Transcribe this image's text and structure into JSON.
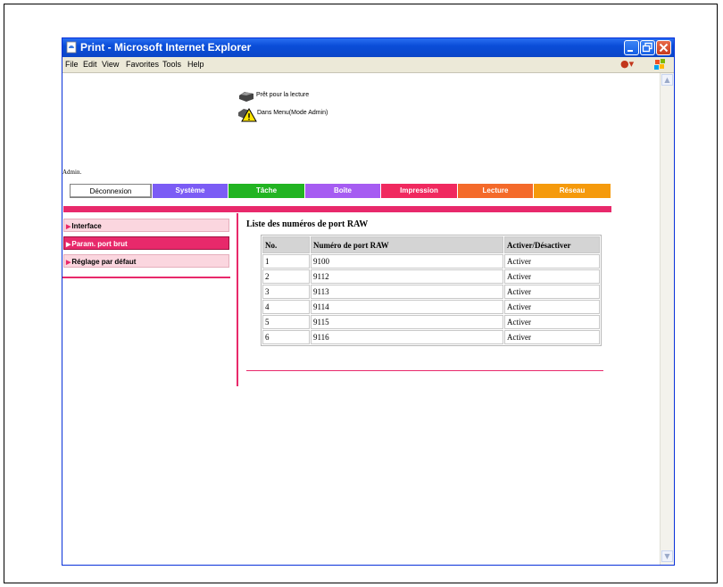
{
  "window": {
    "title": "Print - Microsoft Internet Explorer"
  },
  "menu": {
    "items": [
      "File",
      "Edit",
      "View",
      "Favorites",
      "Tools",
      "Help"
    ]
  },
  "status": {
    "ready": "Prêt pour la lecture",
    "mode": "Dans Menu(Mode Admin)"
  },
  "admin_label": "Admin.",
  "nav": {
    "logout": "Déconnexion",
    "tabs": [
      {
        "label": "Système",
        "color": "#7b5cf5"
      },
      {
        "label": "Tâche",
        "color": "#22b422"
      },
      {
        "label": "Boîte",
        "color": "#a65cf2"
      },
      {
        "label": "Impression",
        "color": "#f0295f"
      },
      {
        "label": "Lecture",
        "color": "#f46a2a"
      },
      {
        "label": "Réseau",
        "color": "#f59a0c"
      }
    ]
  },
  "sidebar": {
    "items": [
      {
        "label": "Interface",
        "active": false
      },
      {
        "label": "Param. port brut",
        "active": true
      },
      {
        "label": "Réglage par défaut",
        "active": false
      }
    ]
  },
  "main": {
    "title": "Liste des numéros de port RAW",
    "table": {
      "headers": [
        "No.",
        "Numéro de port RAW",
        "Activer/Désactiver"
      ],
      "rows": [
        [
          "1",
          "9100",
          "Activer"
        ],
        [
          "2",
          "9112",
          "Activer"
        ],
        [
          "3",
          "9113",
          "Activer"
        ],
        [
          "4",
          "9114",
          "Activer"
        ],
        [
          "5",
          "9115",
          "Activer"
        ],
        [
          "6",
          "9116",
          "Activer"
        ]
      ]
    }
  },
  "colors": {
    "accent": "#e8296b",
    "sidebar_bg": "#fbd6df"
  }
}
